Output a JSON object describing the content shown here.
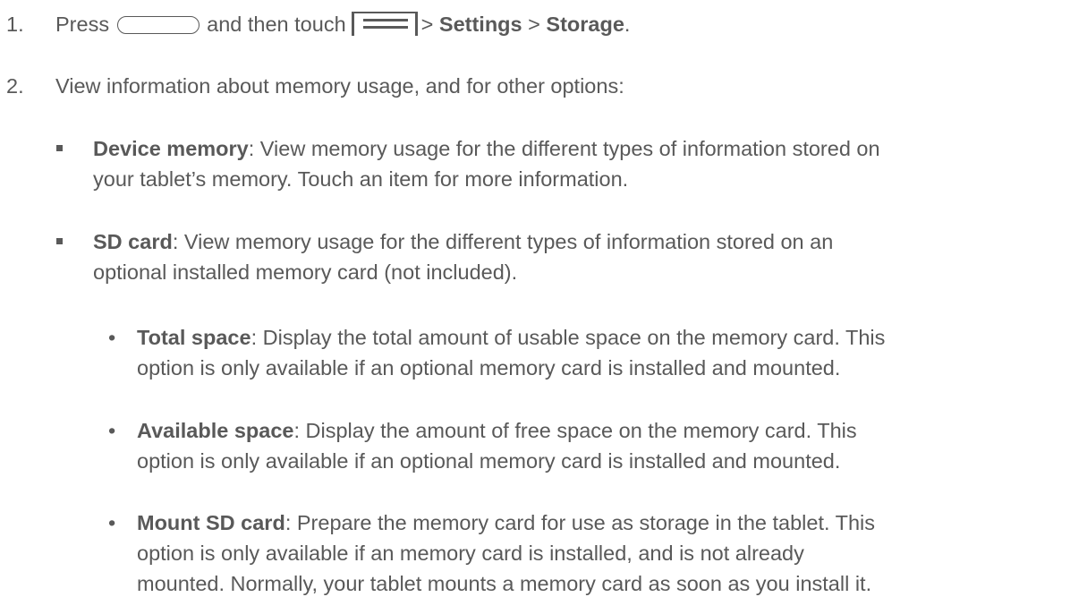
{
  "step1": {
    "number": "1.",
    "press": "Press",
    "and_then_touch": "and then touch",
    "sep1": ">",
    "settings": "Settings",
    "sep2": ">",
    "storage": "Storage",
    "period": ".",
    "icons": [
      "home-key-icon",
      "menu-key-icon"
    ]
  },
  "step2": {
    "number": "2.",
    "text": "View information about memory usage, and for other options:"
  },
  "device_memory": {
    "term": "Device memory",
    "line1": ": View memory usage for the different types of information stored on",
    "line2": "your tablet’s memory. Touch an item for more information."
  },
  "sd_card": {
    "term": "SD card",
    "line1": ": View memory usage for the different types of information stored on an",
    "line2": "optional installed memory card (not included)."
  },
  "total_space": {
    "bullet": "•",
    "term": "Total space",
    "line1": ": Display the total amount of usable space on the memory card. This",
    "line2": "option is only available if an optional memory card is installed and mounted."
  },
  "available_space": {
    "bullet": "•",
    "term": "Available space",
    "line1": ": Display the amount of free space on the memory card. This",
    "line2": "option is only available if an optional memory card is installed and mounted."
  },
  "mount_sd_card": {
    "bullet": "•",
    "term": "Mount SD card",
    "line1": ": Prepare the memory card for use as storage in the tablet. This",
    "line2": "option is only available if an memory card is installed, and is not already",
    "line3": "mounted. Normally, your tablet mounts a memory card as soon as you install it."
  }
}
